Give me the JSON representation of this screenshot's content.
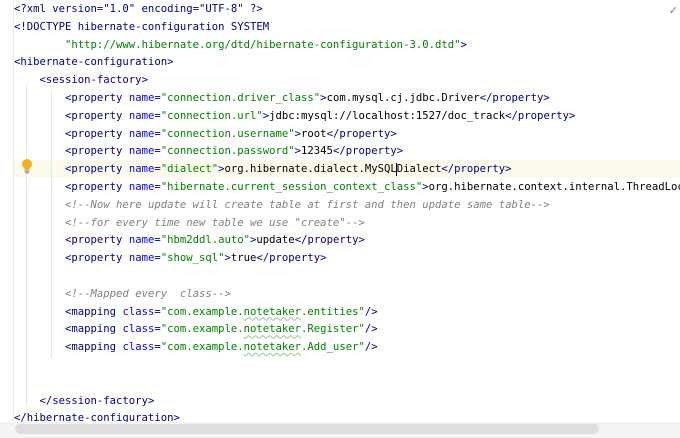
{
  "editor": {
    "lines": [
      {
        "tokens": [
          [
            "xml-tag",
            "&lt;?xml version=\"1.0\" encoding=\"UTF-8\" ?&gt;"
          ]
        ]
      },
      {
        "tokens": [
          [
            "xml-tag",
            "&lt;!DOCTYPE hibernate-configuration SYSTEM"
          ]
        ]
      },
      {
        "indent": "        ",
        "tokens": [
          [
            "val",
            "\"http://www.hibernate.org/dtd/hibernate-configuration-3.0.dtd\""
          ],
          [
            "xml-tag",
            "&gt;"
          ]
        ]
      },
      {
        "tokens": [
          [
            "xml-tag",
            "&lt;hibernate-configuration&gt;"
          ]
        ]
      },
      {
        "indent": "    ",
        "tokens": [
          [
            "xml-tag",
            "&lt;session-factory&gt;"
          ]
        ]
      },
      {
        "indent": "        ",
        "tokens": [
          [
            "xml-tag",
            "&lt;property "
          ],
          [
            "attr",
            "name"
          ],
          [
            "xml-tag",
            "="
          ],
          [
            "val",
            "\"connection.driver_class\""
          ],
          [
            "xml-tag",
            "&gt;"
          ],
          [
            "txt",
            "com.mysql.cj.jdbc.Driver"
          ],
          [
            "xml-tag",
            "&lt;/property&gt;"
          ]
        ]
      },
      {
        "indent": "        ",
        "tokens": [
          [
            "xml-tag",
            "&lt;property "
          ],
          [
            "attr",
            "name"
          ],
          [
            "xml-tag",
            "="
          ],
          [
            "val",
            "\"connection.url\""
          ],
          [
            "xml-tag",
            "&gt;"
          ],
          [
            "txt",
            "jdbc:mysql://localhost:1527/doc_track"
          ],
          [
            "xml-tag",
            "&lt;/property&gt;"
          ]
        ]
      },
      {
        "indent": "        ",
        "tokens": [
          [
            "xml-tag",
            "&lt;property "
          ],
          [
            "attr",
            "name"
          ],
          [
            "xml-tag",
            "="
          ],
          [
            "val",
            "\"connection.username\""
          ],
          [
            "xml-tag",
            "&gt;"
          ],
          [
            "txt",
            "root"
          ],
          [
            "xml-tag",
            "&lt;/property&gt;"
          ]
        ]
      },
      {
        "indent": "        ",
        "tokens": [
          [
            "xml-tag",
            "&lt;property "
          ],
          [
            "attr",
            "name"
          ],
          [
            "xml-tag",
            "="
          ],
          [
            "val",
            "\"connection.password\""
          ],
          [
            "xml-tag",
            "&gt;"
          ],
          [
            "txt",
            "12345"
          ],
          [
            "xml-tag",
            "&lt;/property&gt;"
          ]
        ]
      },
      {
        "indent": "        ",
        "current": true,
        "tokens": [
          [
            "xml-tag",
            "&lt;property "
          ],
          [
            "attr",
            "name"
          ],
          [
            "xml-tag",
            "="
          ],
          [
            "val",
            "\"dialect\""
          ],
          [
            "xml-tag",
            "&gt;"
          ],
          [
            "txt",
            "org.hibernate.dialect.MySQL"
          ],
          [
            "caret",
            ""
          ],
          [
            "txt",
            "Dialect"
          ],
          [
            "xml-tag",
            "&lt;/property&gt;"
          ]
        ]
      },
      {
        "indent": "        ",
        "tokens": [
          [
            "xml-tag",
            "&lt;property "
          ],
          [
            "attr",
            "name"
          ],
          [
            "xml-tag",
            "="
          ],
          [
            "val",
            "\"hibernate.current_session_context_class\""
          ],
          [
            "xml-tag",
            "&gt;"
          ],
          [
            "txt",
            "org.hibernate.context.internal.ThreadLocal"
          ]
        ]
      },
      {
        "indent": "        ",
        "tokens": [
          [
            "cm",
            "&lt;!--Now here update will create table at first and then update same table--&gt;"
          ]
        ]
      },
      {
        "indent": "        ",
        "tokens": [
          [
            "cm",
            "&lt;!--for every time new table we use \"create\"--&gt;"
          ]
        ]
      },
      {
        "indent": "        ",
        "tokens": [
          [
            "xml-tag",
            "&lt;property "
          ],
          [
            "attr",
            "name"
          ],
          [
            "xml-tag",
            "="
          ],
          [
            "val",
            "\"hbm2ddl.auto\""
          ],
          [
            "xml-tag",
            "&gt;"
          ],
          [
            "txt",
            "update"
          ],
          [
            "xml-tag",
            "&lt;/property&gt;"
          ]
        ]
      },
      {
        "indent": "        ",
        "tokens": [
          [
            "xml-tag",
            "&lt;property "
          ],
          [
            "attr",
            "name"
          ],
          [
            "xml-tag",
            "="
          ],
          [
            "val",
            "\"show_sql\""
          ],
          [
            "xml-tag",
            "&gt;"
          ],
          [
            "txt",
            "true"
          ],
          [
            "xml-tag",
            "&lt;/property&gt;"
          ]
        ]
      },
      {
        "tokens": []
      },
      {
        "indent": "        ",
        "tokens": [
          [
            "cm",
            "&lt;!--Mapped every  class--&gt;"
          ]
        ]
      },
      {
        "indent": "        ",
        "tokens": [
          [
            "xml-tag",
            "&lt;mapping "
          ],
          [
            "attr",
            "class"
          ],
          [
            "xml-tag",
            "="
          ],
          [
            "val",
            "\"com.example."
          ],
          [
            "val typo",
            "notetaker"
          ],
          [
            "val",
            ".entities\""
          ],
          [
            "xml-tag",
            "/&gt;"
          ]
        ]
      },
      {
        "indent": "        ",
        "tokens": [
          [
            "xml-tag",
            "&lt;mapping "
          ],
          [
            "attr",
            "class"
          ],
          [
            "xml-tag",
            "="
          ],
          [
            "val",
            "\"com.example."
          ],
          [
            "val typo",
            "notetaker"
          ],
          [
            "val",
            ".Register\""
          ],
          [
            "xml-tag",
            "/&gt;"
          ]
        ]
      },
      {
        "indent": "        ",
        "tokens": [
          [
            "xml-tag",
            "&lt;mapping "
          ],
          [
            "attr",
            "class"
          ],
          [
            "xml-tag",
            "="
          ],
          [
            "val",
            "\"com.example."
          ],
          [
            "val typo",
            "notetaker"
          ],
          [
            "val",
            ".Add_user\""
          ],
          [
            "xml-tag",
            "/&gt;"
          ]
        ]
      },
      {
        "tokens": []
      },
      {
        "tokens": []
      },
      {
        "indent": "    ",
        "tokens": [
          [
            "xml-tag",
            "&lt;/session-factory&gt;"
          ]
        ]
      },
      {
        "tokens": [
          [
            "xml-tag",
            "&lt;/hibernate-configuration&gt;"
          ]
        ]
      }
    ]
  },
  "icons": {
    "gutter_hint": "lightbulb-icon",
    "status": "check-icon"
  },
  "colors": {
    "tag": "#000080",
    "attribute": "#0000ff",
    "string": "#008000",
    "comment": "#808080",
    "current_line": "#fcfaed",
    "bulb": "#f2b21d"
  }
}
